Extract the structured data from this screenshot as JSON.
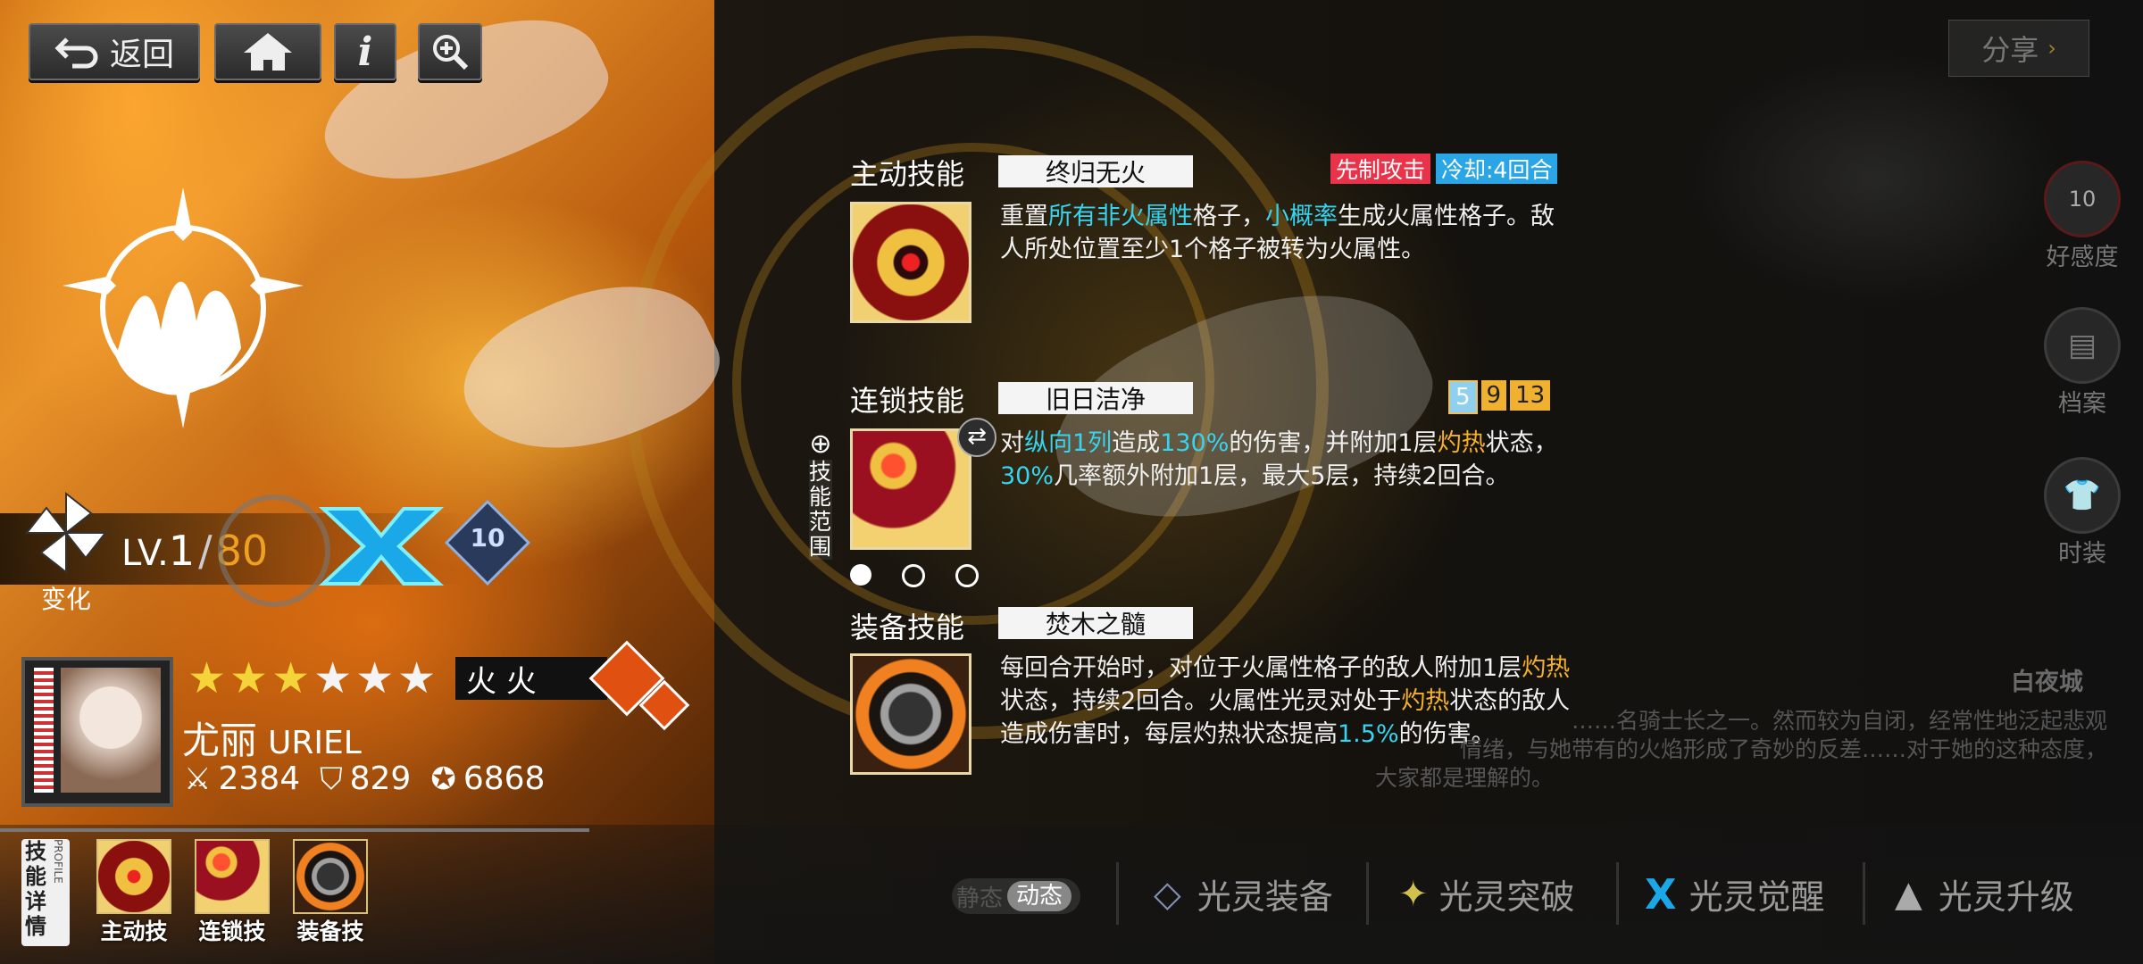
{
  "top_nav": {
    "back_label": "返回",
    "home_icon": "home-icon",
    "info_icon": "info-icon",
    "zoom_icon": "zoom-in-icon",
    "share_label": "分享"
  },
  "character": {
    "name": "尤丽",
    "name_en": "URIEL",
    "level_prefix": "LV.",
    "level": "1",
    "level_sep": "/",
    "level_max": "80",
    "transform_label": "变化",
    "awaken_badge": "10",
    "stars_filled": 3,
    "stars_total": 6,
    "element_label": "火 火",
    "stats": {
      "attack": "2384",
      "defense": "829",
      "hp": "6868"
    }
  },
  "skills": {
    "active": {
      "category": "主动技能",
      "name": "终归无火",
      "tags": [
        "先制攻击",
        "冷却:4回合"
      ],
      "desc": [
        {
          "t": "重置"
        },
        {
          "t": "所有非火属性",
          "c": "cy"
        },
        {
          "t": "格子，"
        },
        {
          "t": "小概率",
          "c": "cy"
        },
        {
          "t": "生成火属性格子。敌人所处位置至少1个格子被转为火属性。"
        }
      ]
    },
    "chain": {
      "category": "连锁技能",
      "name": "旧日洁净",
      "chain_counts": [
        "5",
        "9",
        "13"
      ],
      "range_label": "技能范围",
      "desc": [
        {
          "t": "对"
        },
        {
          "t": "纵向1列",
          "c": "cy"
        },
        {
          "t": "造成"
        },
        {
          "t": "130%",
          "c": "cy"
        },
        {
          "t": "的伤害，并附加1层"
        },
        {
          "t": "灼热",
          "c": "og"
        },
        {
          "t": "状态，"
        },
        {
          "t": "30%",
          "c": "cy"
        },
        {
          "t": "几率额外附加1层，最大5层，持续2回合。"
        }
      ]
    },
    "equip": {
      "category": "装备技能",
      "name": "焚木之髓",
      "desc": [
        {
          "t": "每回合开始时，对位于火属性格子的敌人附加1层"
        },
        {
          "t": "灼热",
          "c": "og"
        },
        {
          "t": "状态，持续2回合。火属性光灵对处于"
        },
        {
          "t": "灼热",
          "c": "og"
        },
        {
          "t": "状态的敌人造成伤害时，每层灼热状态提高"
        },
        {
          "t": "1.5%",
          "c": "cy"
        },
        {
          "t": "的伤害。"
        }
      ]
    }
  },
  "side_menu": [
    {
      "label": "好感度",
      "value": "10"
    },
    {
      "label": "档案"
    },
    {
      "label": "时装"
    }
  ],
  "lore": {
    "title": "白夜城",
    "text_lines": [
      "……名骑士长之一。然而较为自闭，经常性地泛起悲观",
      "情绪，与她带有的火焰形成了奇妙的反差……对于她的这种态度，",
      "大家都是理解的。"
    ]
  },
  "bottom": {
    "skill_detail_label": "技能详情",
    "profile_label": "PROFILE",
    "thumbs": [
      "主动技",
      "连锁技",
      "装备技"
    ],
    "static_label": "静态",
    "dynamic_label": "动态",
    "tabs": [
      "光灵装备",
      "光灵突破",
      "光灵觉醒",
      "光灵升级"
    ]
  },
  "colors": {
    "cyan": "#35d4f0",
    "orange": "#f5b02a",
    "red_tag": "#e8334a",
    "blue_tag": "#2aa6e6"
  }
}
